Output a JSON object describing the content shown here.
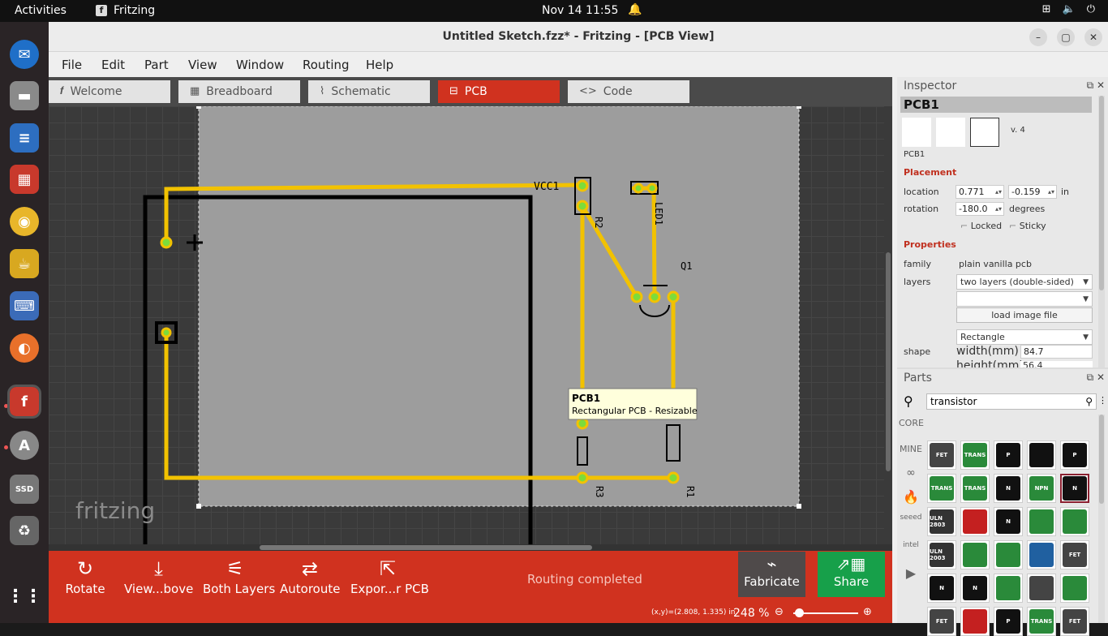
{
  "topbar": {
    "activities": "Activities",
    "app_name": "Fritzing",
    "datetime": "Nov 14  11:55"
  },
  "window": {
    "title": "Untitled Sketch.fzz* - Fritzing - [PCB View]"
  },
  "menu": {
    "items": [
      "File",
      "Edit",
      "Part",
      "View",
      "Window",
      "Routing",
      "Help"
    ]
  },
  "tabs": [
    {
      "label": "Welcome",
      "icon": "fritzing-f-icon"
    },
    {
      "label": "Breadboard",
      "icon": "breadboard-icon"
    },
    {
      "label": "Schematic",
      "icon": "resistor-icon"
    },
    {
      "label": "PCB",
      "icon": "pcb-icon",
      "active": true
    },
    {
      "label": "Code",
      "icon": "code-icon"
    }
  ],
  "canvas": {
    "labels": {
      "vcc": "VCC1",
      "r2": "R2",
      "led": "LED1",
      "q": "Q1",
      "r3": "R3",
      "r1": "R1"
    },
    "watermark": "fritzing",
    "tooltip": {
      "title": "PCB1",
      "subtitle": "Rectangular PCB - Resizable"
    },
    "colors": {
      "trace": "#f2c200",
      "board": "#9d9d9d",
      "pad": "#7ddc3a"
    }
  },
  "toolbar": {
    "rotate": "Rotate",
    "view_above": "View...bove",
    "both_layers": "Both Layers",
    "autoroute": "Autoroute",
    "export_pcb": "Expor...r PCB",
    "status": "Routing completed",
    "fabricate": "Fabricate",
    "share": "Share",
    "coords": "(x,y)=(2.808, 1.335) in",
    "zoom": "248 %"
  },
  "inspector": {
    "title": "Inspector",
    "part_title": "PCB1",
    "version": "v. 4",
    "part_label": "PCB1",
    "placement_header": "Placement",
    "location_label": "location",
    "location_x": "0.771",
    "location_y": "-0.159",
    "location_unit": "in",
    "rotation_label": "rotation",
    "rotation_value": "-180.0",
    "rotation_unit": "degrees",
    "locked_label": "Locked",
    "sticky_label": "Sticky",
    "properties_header": "Properties",
    "family_label": "family",
    "family_value": "plain vanilla pcb",
    "layers_label": "layers",
    "layers_value": "two layers (double-sided)",
    "load_image": "load image file",
    "shape_label": "shape",
    "shape_value": "Rectangle",
    "width_label": "width(mm)",
    "width_value": "84.7",
    "height_label": "height(mm)",
    "height_value": "56.4"
  },
  "parts": {
    "title": "Parts",
    "search_value": "transistor",
    "bins": [
      "CORE",
      "MINE"
    ],
    "items": [
      {
        "label": "FET",
        "color": "#444"
      },
      {
        "label": "TRANS",
        "color": "#2a8a3a"
      },
      {
        "label": "P",
        "color": "#111"
      },
      {
        "label": "",
        "color": "#111"
      },
      {
        "label": "P",
        "color": "#111"
      },
      {
        "label": "TRANS",
        "color": "#2a8a3a"
      },
      {
        "label": "TRANS",
        "color": "#2a8a3a"
      },
      {
        "label": "N",
        "color": "#111"
      },
      {
        "label": "NPN",
        "color": "#2a8a3a"
      },
      {
        "label": "N",
        "color": "#111"
      },
      {
        "label": "ULN 2803",
        "color": "#333"
      },
      {
        "label": "",
        "color": "#c42020"
      },
      {
        "label": "N",
        "color": "#111"
      },
      {
        "label": "",
        "color": "#2a8a3a"
      },
      {
        "label": "",
        "color": "#2a8a3a"
      },
      {
        "label": "ULN 2003",
        "color": "#333"
      },
      {
        "label": "",
        "color": "#2a8a3a"
      },
      {
        "label": "",
        "color": "#2a8a3a"
      },
      {
        "label": "",
        "color": "#2060a0"
      },
      {
        "label": "FET",
        "color": "#444"
      },
      {
        "label": "N",
        "color": "#111"
      },
      {
        "label": "N",
        "color": "#111"
      },
      {
        "label": "",
        "color": "#2a8a3a"
      },
      {
        "label": "",
        "color": "#444"
      },
      {
        "label": "",
        "color": "#2a8a3a"
      },
      {
        "label": "FET",
        "color": "#444"
      },
      {
        "label": "",
        "color": "#c42020"
      },
      {
        "label": "P",
        "color": "#111"
      },
      {
        "label": "TRANS",
        "color": "#2a8a3a"
      },
      {
        "label": "FET",
        "color": "#444"
      }
    ]
  }
}
